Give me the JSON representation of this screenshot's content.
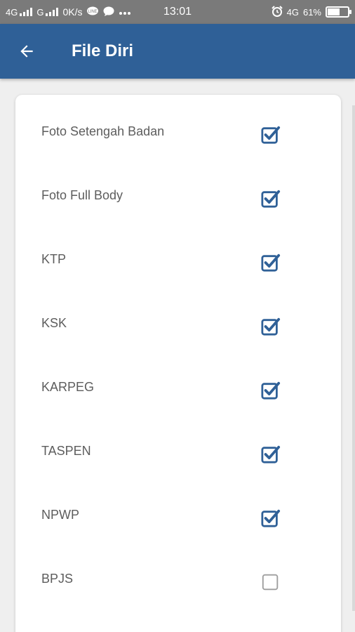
{
  "status_bar": {
    "net1": "4G",
    "net2": "G",
    "speed": "0K/s",
    "time": "13:01",
    "net3": "4G",
    "battery_text": "61%",
    "battery_level": 0.61
  },
  "app_bar": {
    "title": "File Diri",
    "back_icon": "arrow-back-icon"
  },
  "colors": {
    "app_bar": "#2f6097",
    "checkbox_checked": "#2f6097",
    "checkbox_unchecked": "#9e9e9e",
    "label": "#5d5d5d"
  },
  "items": [
    {
      "label": "Foto Setengah Badan",
      "checked": true
    },
    {
      "label": "Foto Full Body",
      "checked": true
    },
    {
      "label": "KTP",
      "checked": true
    },
    {
      "label": "KSK",
      "checked": true
    },
    {
      "label": "KARPEG",
      "checked": true
    },
    {
      "label": "TASPEN",
      "checked": true
    },
    {
      "label": "NPWP",
      "checked": true
    },
    {
      "label": "BPJS",
      "checked": false
    }
  ]
}
